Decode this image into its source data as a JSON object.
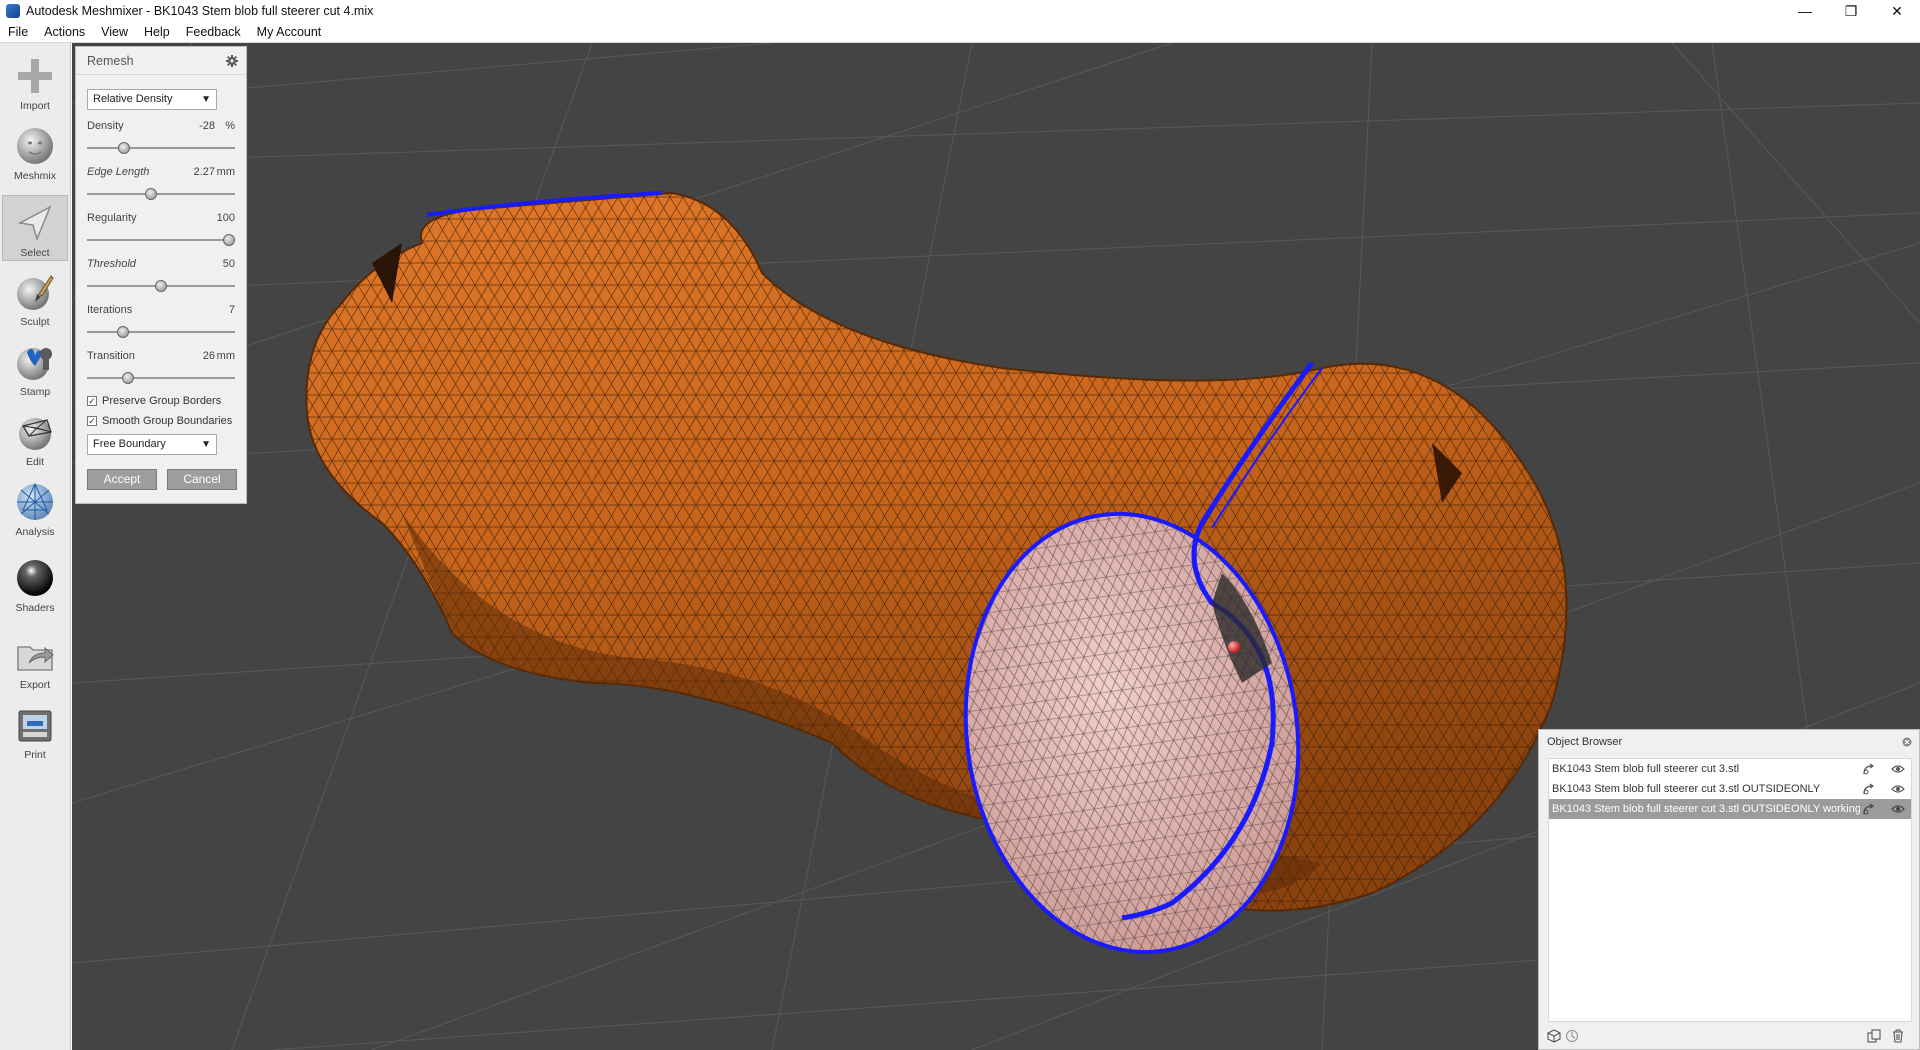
{
  "window": {
    "title": "Autodesk Meshmixer - BK1043 Stem blob full steerer cut 4.mix",
    "minimize": "—",
    "restore": "❐",
    "close": "✕"
  },
  "menu": [
    "File",
    "Actions",
    "View",
    "Help",
    "Feedback",
    "My Account"
  ],
  "toolbar": {
    "items": [
      {
        "label": "Import",
        "icon": "plus-icon"
      },
      {
        "label": "Meshmix",
        "icon": "face-sphere-icon"
      },
      {
        "label": "Select",
        "icon": "cursor-arrow-icon",
        "active": true
      },
      {
        "label": "Sculpt",
        "icon": "brush-sphere-icon"
      },
      {
        "label": "Stamp",
        "icon": "fleur-stamp-icon"
      },
      {
        "label": "Edit",
        "icon": "edit-sphere-icon"
      },
      {
        "label": "Analysis",
        "icon": "mesh-sphere-icon"
      },
      {
        "label": "Shaders",
        "icon": "black-sphere-icon"
      },
      {
        "label": "Export",
        "icon": "export-folder-icon"
      },
      {
        "label": "Print",
        "icon": "printer-icon"
      }
    ]
  },
  "remesh": {
    "title": "Remesh",
    "mode": "Relative Density",
    "params": [
      {
        "label": "Density",
        "value": "-28",
        "unit": "%",
        "italic": false,
        "slider": 0.25
      },
      {
        "label": "Edge Length",
        "value": "2.27",
        "unit": "mm",
        "italic": true,
        "slider": 0.43
      },
      {
        "label": "Regularity",
        "value": "100",
        "unit": "",
        "italic": false,
        "slider": 1.0
      },
      {
        "label": "Threshold",
        "value": "50",
        "unit": "",
        "italic": true,
        "slider": 0.5
      },
      {
        "label": "Iterations",
        "value": "7",
        "unit": "",
        "italic": false,
        "slider": 0.24
      },
      {
        "label": "Transition",
        "value": "26",
        "unit": "mm",
        "italic": false,
        "slider": 0.28
      }
    ],
    "preserve_group_borders": "Preserve Group Borders",
    "smooth_group_boundaries": "Smooth Group Boundaries",
    "boundary_mode": "Free Boundary",
    "accept": "Accept",
    "cancel": "Cancel"
  },
  "object_browser": {
    "title": "Object Browser",
    "items": [
      {
        "name": "BK1043 Stem blob full steerer cut 3.stl",
        "selected": false
      },
      {
        "name": "BK1043 Stem blob full steerer cut 3.stl OUTSIDEONLY",
        "selected": false
      },
      {
        "name": "BK1043 Stem blob full steerer cut 3.stl OUTSIDEONLY working",
        "selected": true
      }
    ]
  },
  "colors": {
    "viewport_bg": "#444444",
    "mesh_orange": "#c9661a",
    "selection_pink": "#e3b4b0",
    "boundary_blue": "#1a1aff"
  }
}
